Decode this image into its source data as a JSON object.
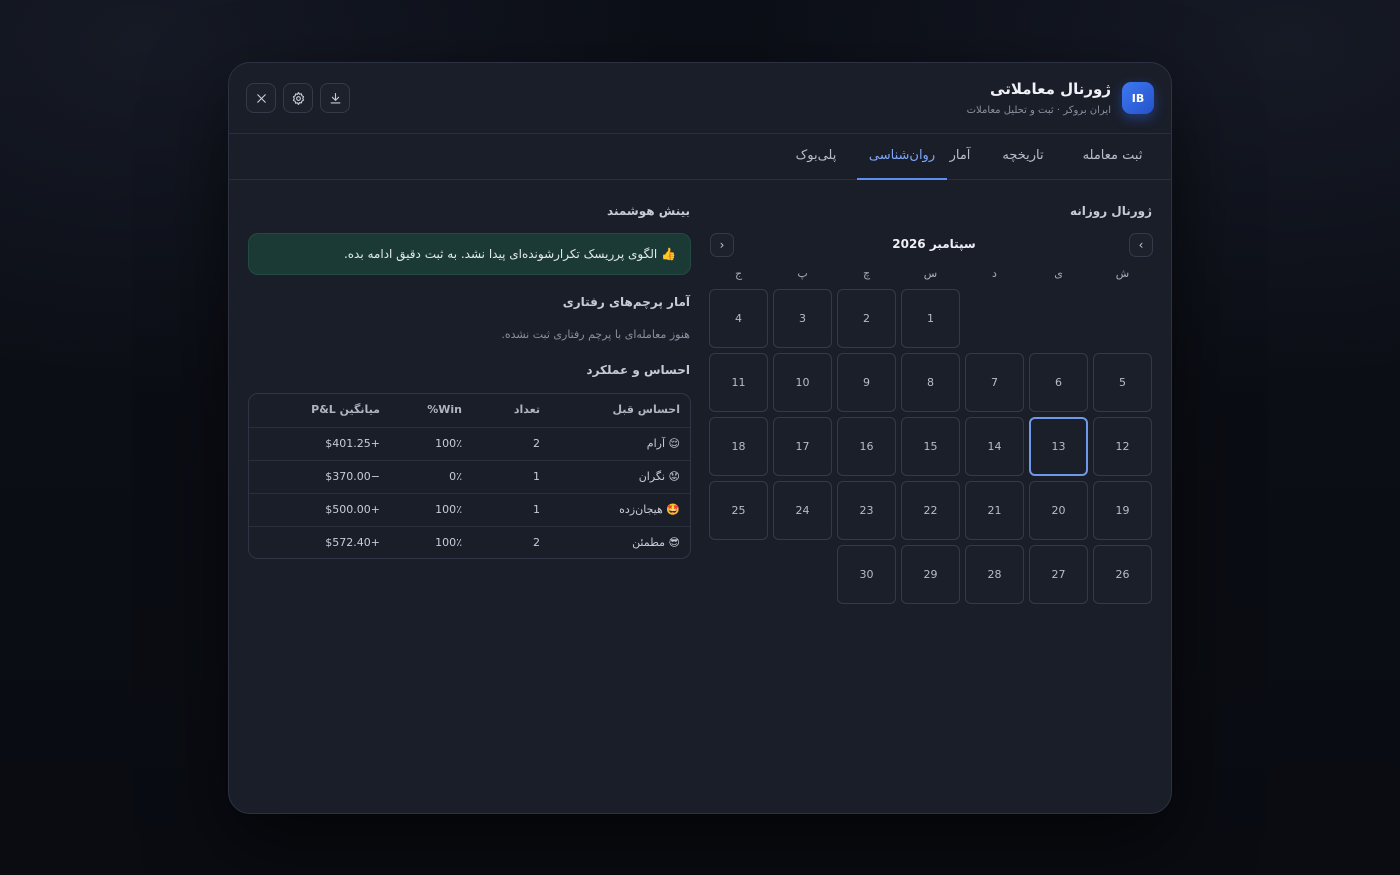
{
  "header": {
    "logo_text": "IB",
    "title": "ژورنال معاملاتی",
    "subtitle": "ایران بروکر · ثبت و تحلیل معاملات",
    "buttons": [
      {
        "name": "close-button",
        "icon": "close-icon"
      },
      {
        "name": "settings-button",
        "icon": "gear-icon"
      },
      {
        "name": "download-button",
        "icon": "download-icon"
      }
    ]
  },
  "tabs": [
    {
      "label": "ثبت معامله",
      "active": false
    },
    {
      "label": "تاریخچه",
      "active": false
    },
    {
      "label": "آمار",
      "active": false
    },
    {
      "label": "روان‌شناسی",
      "active": true
    },
    {
      "label": "پلی‌بوک",
      "active": false
    }
  ],
  "insight": {
    "title": "بینش هوشمند",
    "message": "👍 الگوی پرریسک تکرارشونده‌ای پیدا نشد. به ثبت دقیق ادامه بده."
  },
  "flags": {
    "title": "آمار پرچم‌های رفتاری",
    "empty_text": "هنوز معامله‌ای با پرچم رفتاری ثبت نشده."
  },
  "performance": {
    "title": "احساس و عملکرد",
    "headers": {
      "mood": "احساس قبل",
      "count": "تعداد",
      "win": "Win%",
      "pnl": "میانگین P&L"
    },
    "rows": [
      {
        "mood": "😌 آرام",
        "count": "2",
        "win": "100٪",
        "pnl": "+$401.25"
      },
      {
        "mood": "😟 نگران",
        "count": "1",
        "win": "0٪",
        "pnl": "−$370.00"
      },
      {
        "mood": "🤩 هیجان‌زده",
        "count": "1",
        "win": "100٪",
        "pnl": "+$500.00"
      },
      {
        "mood": "😎 مطمئن",
        "count": "2",
        "win": "100٪",
        "pnl": "+$572.40"
      }
    ]
  },
  "calendar": {
    "title": "ژورنال روزانه",
    "month": "سپتامبر 2026",
    "prev_label": "‹",
    "next_label": "›",
    "weekdays": [
      "ش",
      "ی",
      "د",
      "س",
      "چ",
      "پ",
      "ج"
    ],
    "selected_day": 13,
    "weeks": [
      [
        "",
        "",
        "",
        "1",
        "2",
        "3",
        "4"
      ],
      [
        "5",
        "6",
        "7",
        "8",
        "9",
        "10",
        "11"
      ],
      [
        "12",
        "13",
        "14",
        "15",
        "16",
        "17",
        "18"
      ],
      [
        "19",
        "20",
        "21",
        "22",
        "23",
        "24",
        "25"
      ],
      [
        "26",
        "27",
        "28",
        "29",
        "30",
        "",
        ""
      ]
    ]
  }
}
